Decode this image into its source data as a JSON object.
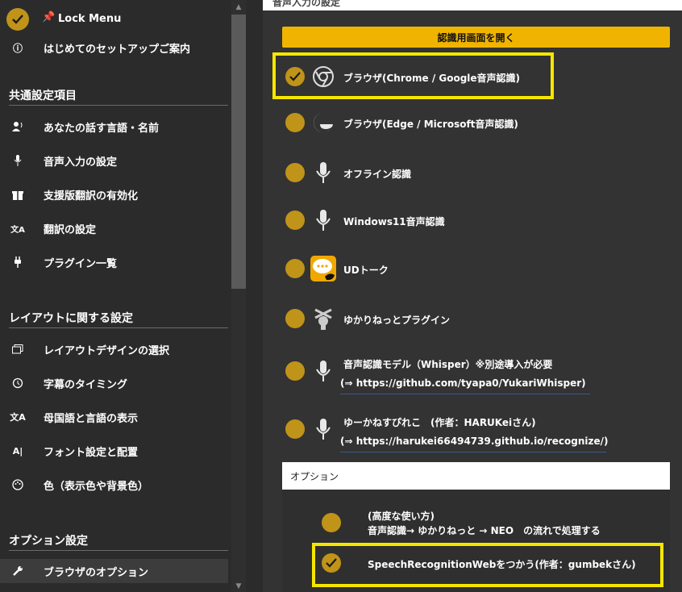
{
  "sidebar": {
    "lock_label": "Lock Menu",
    "setup_label": "はじめてのセットアップご案内",
    "sections": [
      {
        "title": "共通設定項目"
      },
      {
        "title": "レイアウトに関する設定"
      },
      {
        "title": "オプション設定"
      }
    ],
    "items": [
      {
        "label": "あなたの話す言語・名前",
        "icon": "person-voice-icon"
      },
      {
        "label": "音声入力の設定",
        "icon": "microphone-icon"
      },
      {
        "label": "支援版翻訳の有効化",
        "icon": "gift-icon"
      },
      {
        "label": "翻訳の設定",
        "icon": "translate-icon"
      },
      {
        "label": "プラグイン一覧",
        "icon": "plug-icon"
      },
      {
        "label": "レイアウトデザインの選択",
        "icon": "layout-icon"
      },
      {
        "label": "字幕のタイミング",
        "icon": "clock-icon"
      },
      {
        "label": "母国語と言語の表示",
        "icon": "language-icon"
      },
      {
        "label": "フォント設定と配置",
        "icon": "font-icon"
      },
      {
        "label": "色（表示色や背景色）",
        "icon": "palette-icon"
      },
      {
        "label": "ブラウザのオプション",
        "icon": "wrench-icon"
      }
    ]
  },
  "main": {
    "top_strip_text": "音声入力の設定",
    "open_button_label": "認識用画面を開く",
    "options": [
      {
        "label": "ブラウザ(Chrome / Google音声認識)",
        "icon": "chrome-icon",
        "selected": true
      },
      {
        "label": "ブラウザ(Edge / Microsoft音声認識)",
        "icon": "edge-icon",
        "selected": false
      },
      {
        "label": "オフライン認識",
        "icon": "microphone-icon",
        "selected": false
      },
      {
        "label": "Windows11音声認識",
        "icon": "microphone-icon",
        "selected": false
      },
      {
        "label": "UDトーク",
        "icon": "udtalk-icon",
        "selected": false
      },
      {
        "label": "ゆかりねっとプラグイン",
        "icon": "yukarinette-icon",
        "selected": false
      },
      {
        "label": "音声認識モデル（Whisper）※別途導入が必要",
        "link": "(⇒ https://github.com/tyapa0/YukariWhisper)",
        "icon": "microphone-icon",
        "selected": false
      },
      {
        "label": "ゆーかねすぴれこ　(作者：HARUKeiさん)",
        "link": "(⇒ https://harukei66494739.github.io/recognize/)",
        "icon": "microphone-icon",
        "selected": false
      }
    ],
    "options_box": {
      "title": "オプション",
      "advanced_line1": "(高度な使い方)",
      "advanced_line2": "音声認識→ ゆかりねっと → NEO　の流れで処理する",
      "speech_web_label": "SpeechRecognitionWebをつかう(作者：gumbekさん)",
      "speech_web_checked": true
    }
  },
  "colors": {
    "accent": "#c09319",
    "button": "#f0b400",
    "highlight": "#f5e600",
    "background": "#2b2b2b"
  }
}
